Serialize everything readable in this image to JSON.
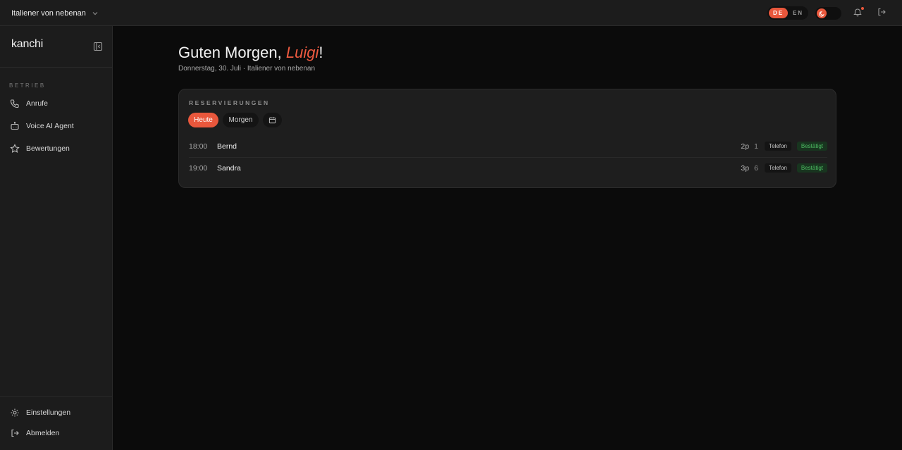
{
  "topbar": {
    "org_name": "Italiener von nebenan",
    "lang_active": "DE",
    "lang_inactive": "EN",
    "accent": "#e9573c"
  },
  "sidebar": {
    "brand": "kanchi",
    "section_label": "BETRIEB",
    "items": [
      {
        "label": "Anrufe",
        "icon": "phone-icon"
      },
      {
        "label": "Voice AI Agent",
        "icon": "bot-icon"
      },
      {
        "label": "Bewertungen",
        "icon": "star-icon"
      }
    ],
    "bottom_items": [
      {
        "label": "Einstellungen",
        "icon": "gear-icon"
      },
      {
        "label": "Abmelden",
        "icon": "logout-icon"
      }
    ]
  },
  "main": {
    "greeting_prefix": "Guten Morgen,",
    "greeting_name": "Luigi",
    "greeting_suffix": "!",
    "subline": "Donnerstag, 30. Juli · Italiener von nebenan",
    "reservations": {
      "title": "RESERVIERUNGEN",
      "tabs": [
        "Heute",
        "Morgen"
      ],
      "rows": [
        {
          "time": "18:00",
          "guest": "Bernd",
          "party": "2p",
          "table": "1",
          "source": "Telefon",
          "status": "Bestätigt"
        },
        {
          "time": "19:00",
          "guest": "Sandra",
          "party": "3p",
          "table": "6",
          "source": "Telefon",
          "status": "Bestätigt"
        }
      ]
    }
  }
}
